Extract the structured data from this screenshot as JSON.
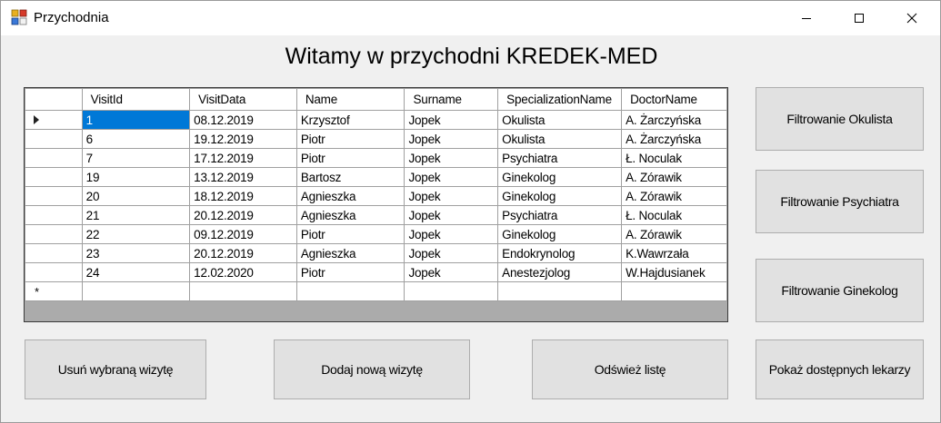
{
  "window": {
    "title": "Przychodnia"
  },
  "heading": "Witamy w przychodni KREDEK-MED",
  "grid": {
    "columns": [
      "VisitId",
      "VisitData",
      "Name",
      "Surname",
      "SpecializationName",
      "DoctorName"
    ],
    "rows": [
      [
        "1",
        "08.12.2019",
        "Krzysztof",
        "Jopek",
        "Okulista",
        "A. Żarczyńska"
      ],
      [
        "6",
        "19.12.2019",
        "Piotr",
        "Jopek",
        "Okulista",
        "A. Żarczyńska"
      ],
      [
        "7",
        "17.12.2019",
        "Piotr",
        "Jopek",
        "Psychiatra",
        "Ł. Noculak"
      ],
      [
        "19",
        "13.12.2019",
        "Bartosz",
        "Jopek",
        "Ginekolog",
        "A. Zórawik"
      ],
      [
        "20",
        "18.12.2019",
        "Agnieszka",
        "Jopek",
        "Ginekolog",
        "A. Zórawik"
      ],
      [
        "21",
        "20.12.2019",
        "Agnieszka",
        "Jopek",
        "Psychiatra",
        "Ł. Noculak"
      ],
      [
        "22",
        "09.12.2019",
        "Piotr",
        "Jopek",
        "Ginekolog",
        "A. Zórawik"
      ],
      [
        "23",
        "20.12.2019",
        "Agnieszka",
        "Jopek",
        "Endokrynolog",
        "K.Wawrzała"
      ],
      [
        "24",
        "12.02.2020",
        "Piotr",
        "Jopek",
        "Anestezjolog",
        "W.Hajdusianek"
      ]
    ],
    "new_row_marker": "*"
  },
  "buttons": {
    "filter_okulista": "Filtrowanie Okulista",
    "filter_psychiatra": "Filtrowanie Psychiatra",
    "filter_ginekolog": "Filtrowanie Ginekolog",
    "delete_visit": "Usuń wybraną wizytę",
    "add_visit": "Dodaj nową wizytę",
    "refresh": "Odśwież listę",
    "show_doctors": "Pokaż dostępnych lekarzy"
  },
  "colors": {
    "selection": "#0078d7",
    "button_bg": "#e1e1e1",
    "window_bg": "#f0f0f0"
  }
}
